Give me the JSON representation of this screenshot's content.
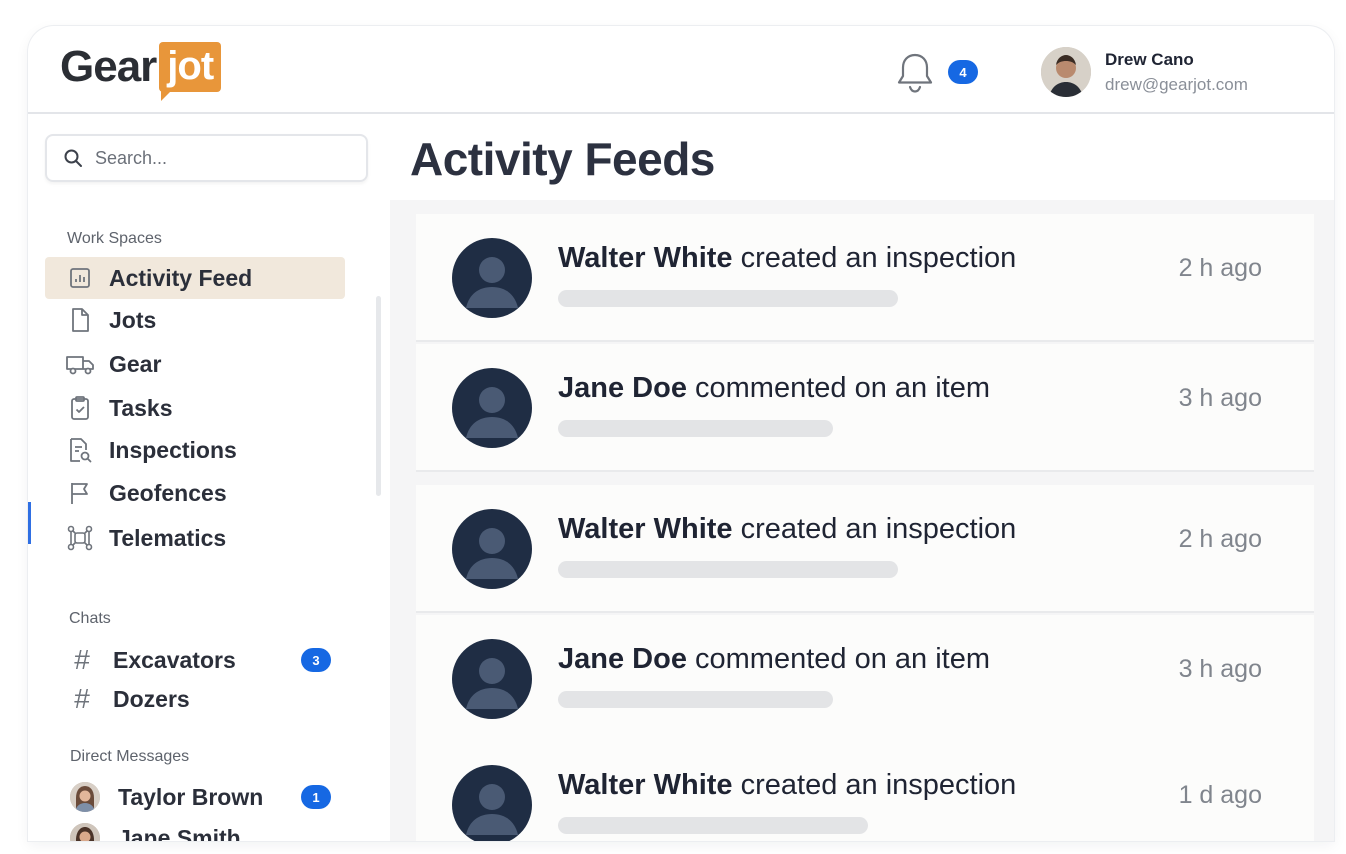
{
  "app": {
    "logo_part1": "Gear",
    "logo_part2": "jot",
    "brand_color": "#e8963a",
    "accent_color": "#1668e3"
  },
  "header": {
    "notification_count": "4",
    "user": {
      "name": "Drew Cano",
      "email": "drew@gearjot.com"
    }
  },
  "search": {
    "placeholder": "Search..."
  },
  "sidebar": {
    "workspaces_title": "Work Spaces",
    "items": [
      {
        "label": "Activity Feed",
        "icon": "bar-chart-icon",
        "active": true
      },
      {
        "label": "Jots",
        "icon": "document-icon"
      },
      {
        "label": "Gear",
        "icon": "truck-icon"
      },
      {
        "label": "Tasks",
        "icon": "clipboard-check-icon"
      },
      {
        "label": "Inspections",
        "icon": "document-search-icon"
      },
      {
        "label": "Geofences",
        "icon": "flag-icon"
      },
      {
        "label": "Telematics",
        "icon": "network-icon"
      }
    ],
    "chats_title": "Chats",
    "chats": [
      {
        "label": "Excavators",
        "badge": "3"
      },
      {
        "label": "Dozers",
        "badge": ""
      }
    ],
    "dm_title": "Direct Messages",
    "direct_messages": [
      {
        "label": "Taylor Brown",
        "badge": "1"
      },
      {
        "label": "Jane Smith",
        "badge": ""
      }
    ]
  },
  "main": {
    "title": "Activity Feeds",
    "feed": [
      {
        "name": "Walter White",
        "action": "created an inspection",
        "time": "2 h ago"
      },
      {
        "name": "Jane Doe",
        "action": "commented on an item",
        "time": "3 h ago"
      },
      {
        "name": "Walter White",
        "action": "created an inspection",
        "time": "2 h ago"
      },
      {
        "name": "Jane Doe",
        "action": "commented on an item",
        "time": "3 h ago"
      },
      {
        "name": "Walter White",
        "action": "created an inspection",
        "time": "1 d ago"
      }
    ]
  }
}
